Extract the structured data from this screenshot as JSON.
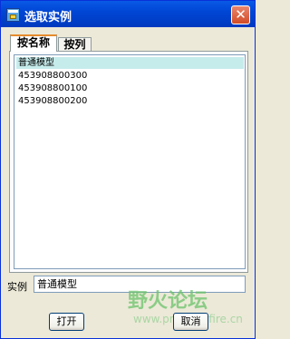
{
  "window": {
    "title": "选取实例",
    "close_label": "✕"
  },
  "tabs": [
    {
      "label": "按名称",
      "active": true
    },
    {
      "label": "按列",
      "active": false
    }
  ],
  "list": {
    "items": [
      {
        "label": "普通模型",
        "selected": true
      },
      {
        "label": "453908800300",
        "selected": false
      },
      {
        "label": "453908800100",
        "selected": false
      },
      {
        "label": "453908800200",
        "selected": false
      }
    ]
  },
  "instance": {
    "label": "实例",
    "value": "普通模型"
  },
  "buttons": {
    "open_label": "打开",
    "cancel_label": "取消"
  },
  "watermark": {
    "text": "野火论坛",
    "url": "www.proewildfire.cn"
  }
}
